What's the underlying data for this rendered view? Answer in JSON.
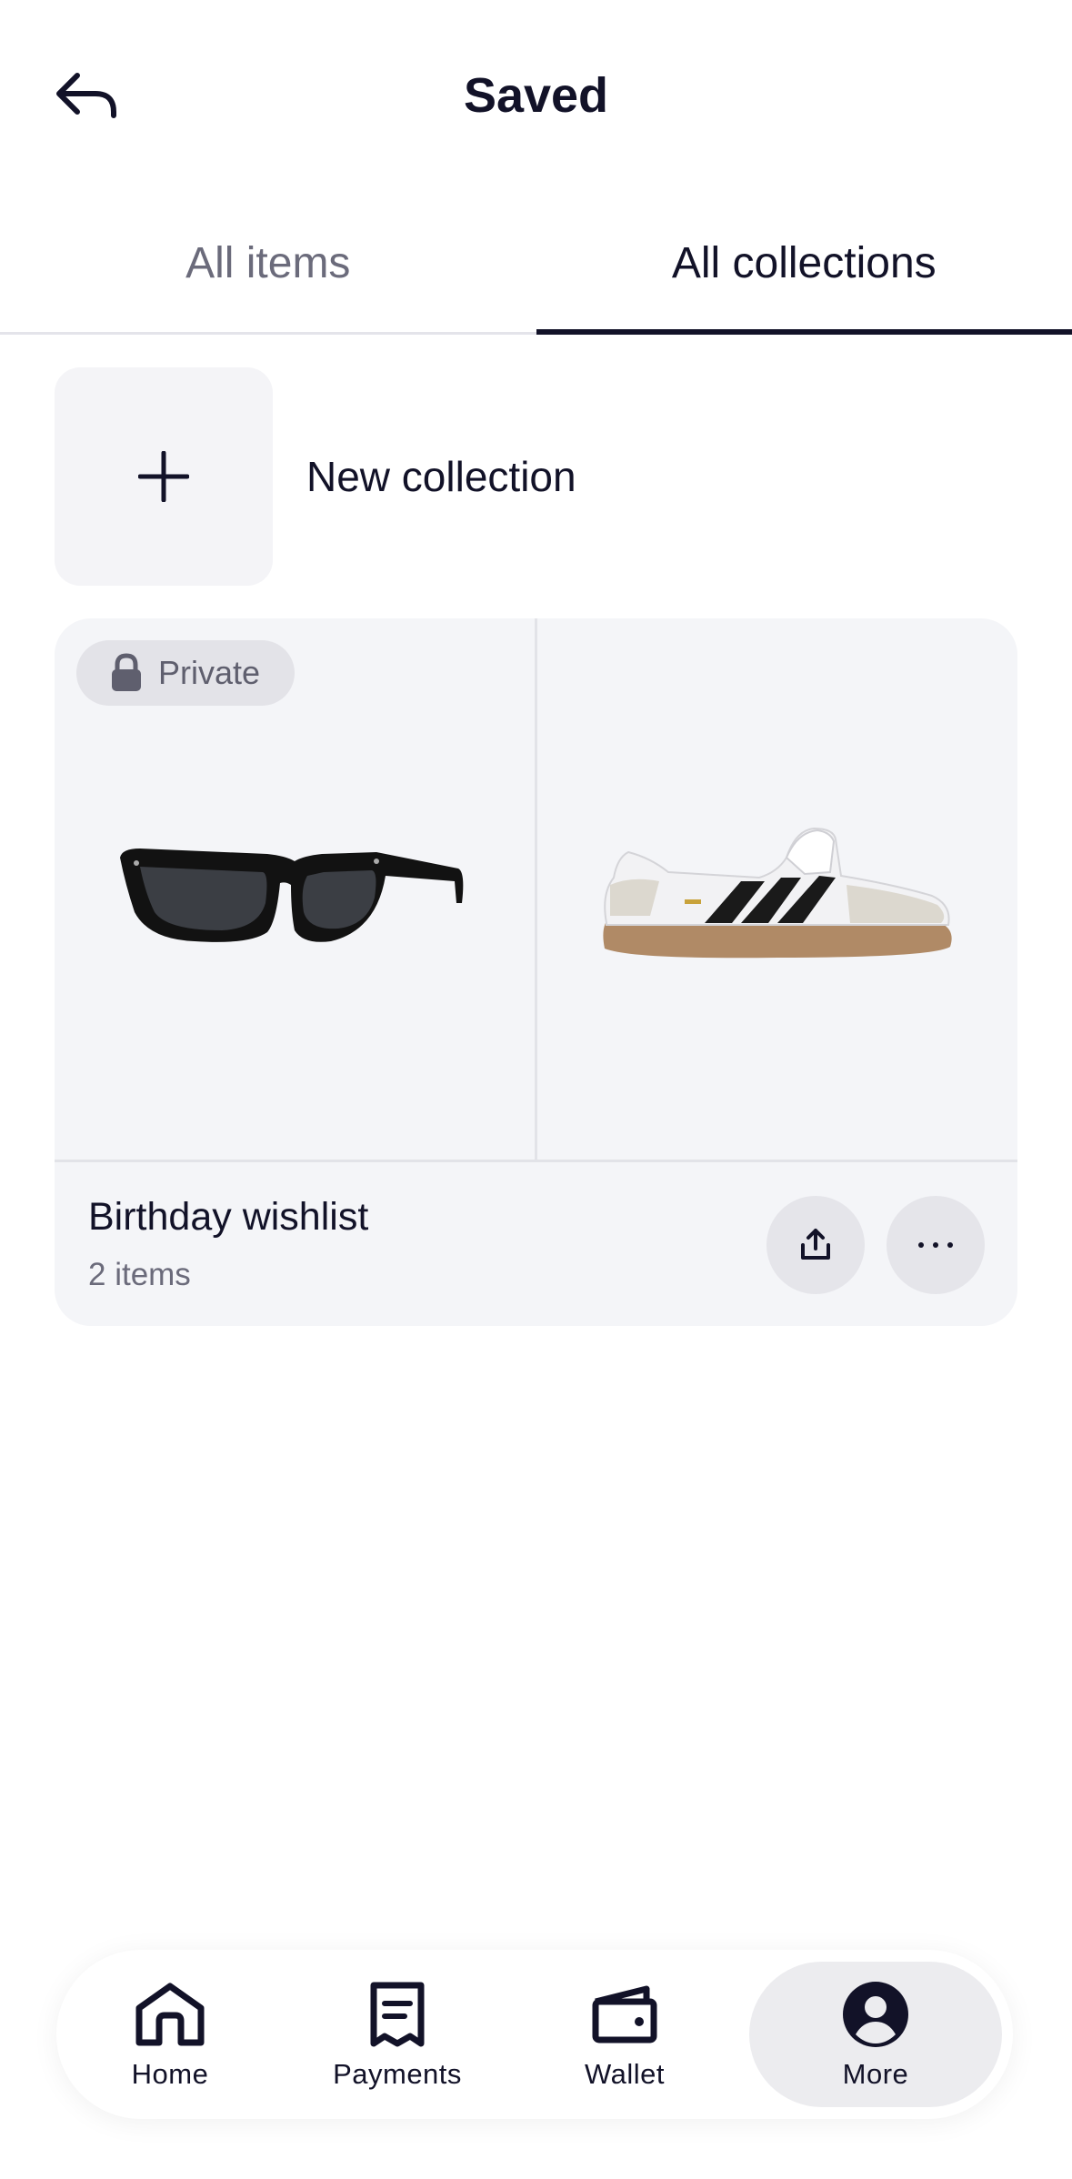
{
  "header": {
    "title": "Saved"
  },
  "tabs": [
    {
      "label": "All items",
      "active": false
    },
    {
      "label": "All collections",
      "active": true
    }
  ],
  "new_collection": {
    "label": "New collection"
  },
  "collection": {
    "badge": "Private",
    "name": "Birthday wishlist",
    "count": "2 items",
    "images": [
      "sunglasses",
      "sneaker"
    ]
  },
  "nav": [
    {
      "label": "Home",
      "icon": "home-icon"
    },
    {
      "label": "Payments",
      "icon": "receipt-icon"
    },
    {
      "label": "Wallet",
      "icon": "wallet-icon"
    },
    {
      "label": "More",
      "icon": "account-icon",
      "active": true
    }
  ],
  "colors": {
    "text": "#121228",
    "muted": "#6b6b7b",
    "card_bg": "#f4f5f8"
  }
}
